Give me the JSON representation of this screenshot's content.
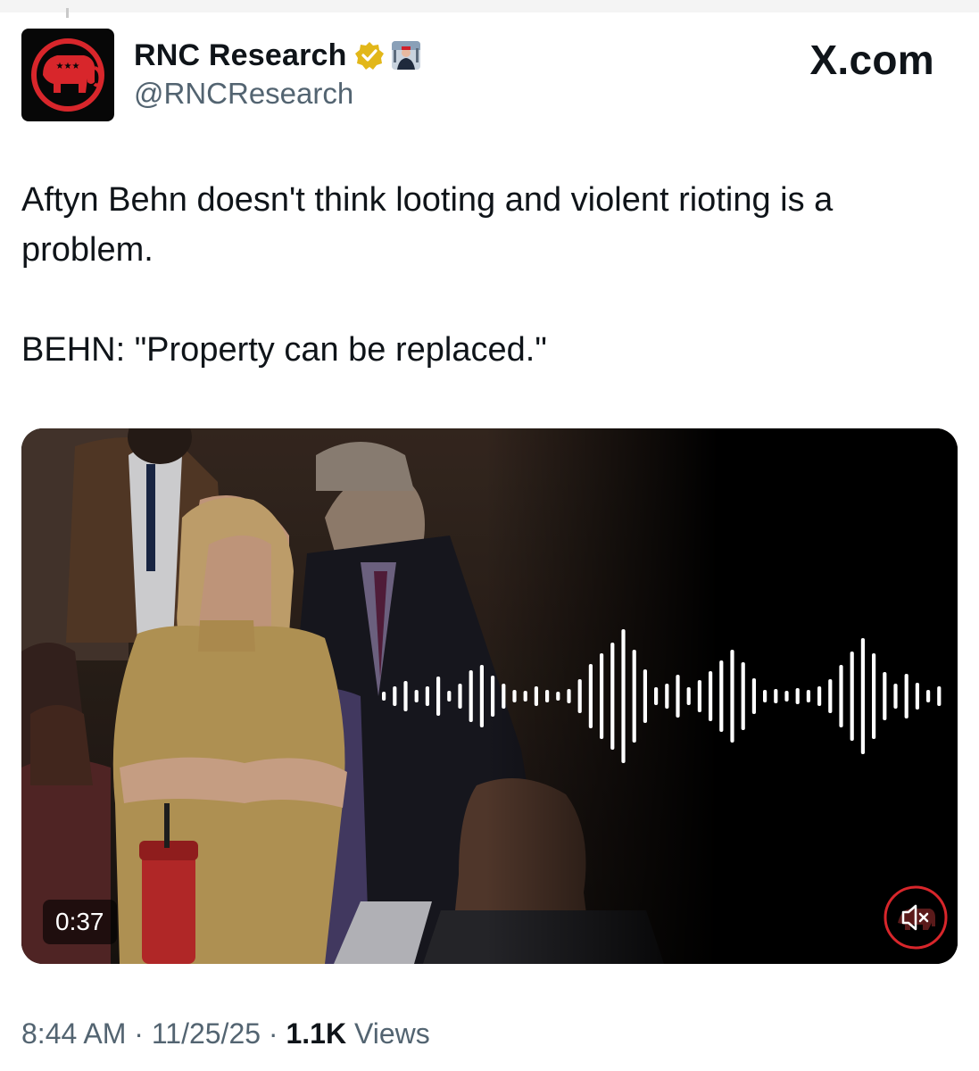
{
  "post": {
    "author": {
      "display_name": "RNC Research",
      "handle": "@RNCResearch",
      "verified_badge_icon": "gold-checkmark-icon",
      "avatar_icon": "republican-elephant-logo",
      "brand_color": "#d8262b"
    },
    "site_label": "X.com",
    "text_lines": [
      "Aftyn Behn doesn't think looting and violent rioting is a problem.",
      "BEHN: \"Property can be replaced.\""
    ],
    "media": {
      "type": "video",
      "duration": "0:37",
      "overlay_icon": "audio-waveform-icon",
      "mute_icon": "speaker-muted-icon"
    },
    "meta": {
      "time": "8:44 AM",
      "separator": "·",
      "date": "11/25/25",
      "views_count": "1.1K",
      "views_label": "Views"
    }
  }
}
